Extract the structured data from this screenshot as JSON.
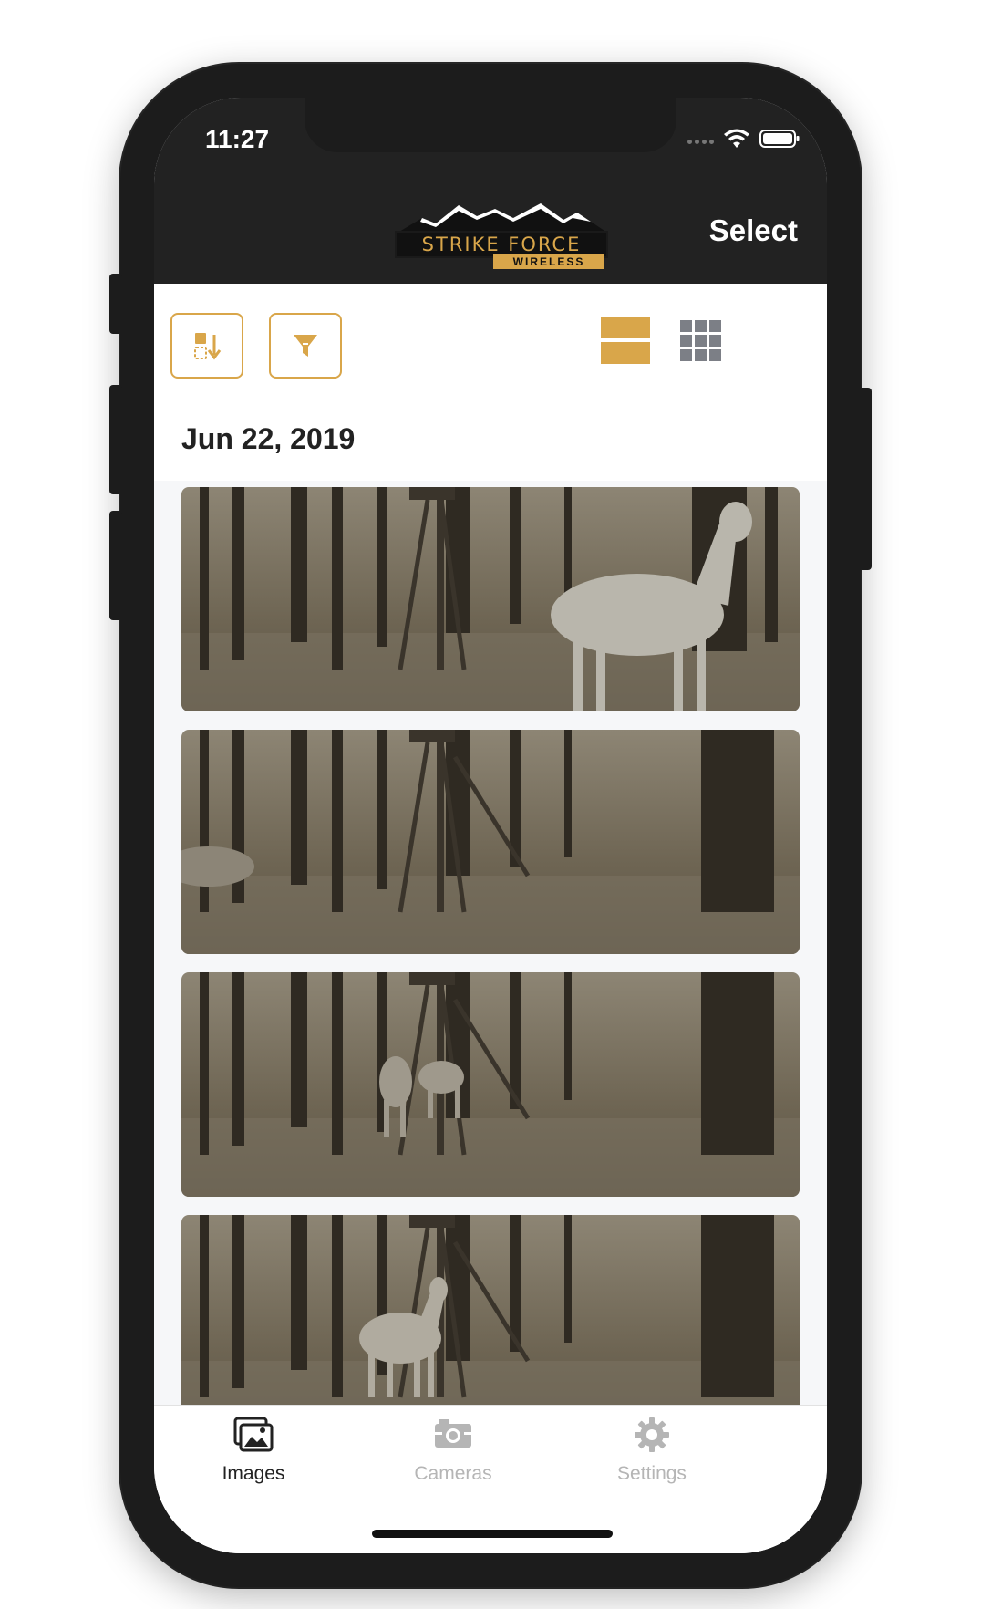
{
  "status_bar": {
    "time": "11:27"
  },
  "header": {
    "logo_main": "STRIKE FORCE",
    "logo_sub": "WIRELESS",
    "select_label": "Select"
  },
  "toolbar": {
    "sort_icon": "sort-icon",
    "filter_icon": "filter-icon",
    "view_list_icon": "list-view-icon",
    "view_grid_icon": "grid-view-icon"
  },
  "gallery": {
    "date_header": "Jun 22, 2019",
    "photos": [
      {
        "subject": "deer"
      },
      {
        "subject": "deer"
      },
      {
        "subject": "deer"
      },
      {
        "subject": "deer"
      }
    ]
  },
  "tab_bar": {
    "tabs": [
      {
        "label": "Images",
        "icon": "images-icon",
        "active": true
      },
      {
        "label": "Cameras",
        "icon": "camera-icon",
        "active": false
      },
      {
        "label": "Settings",
        "icon": "gear-icon",
        "active": false
      }
    ]
  },
  "colors": {
    "accent": "#d9a64a",
    "navbar": "#222222",
    "inactive_tab": "#b5b5b5"
  }
}
